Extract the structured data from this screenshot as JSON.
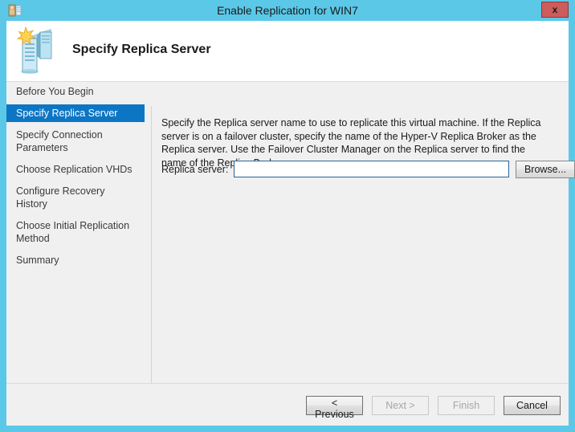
{
  "window": {
    "title": "Enable Replication for WIN7",
    "title_icon": "vm-replication-icon",
    "close_label": "x",
    "frame_color": "#5bc8e8",
    "titlebar_color": "#5bc8e8",
    "close_color": "#cd5c5c",
    "accent_color": "#0d76c4"
  },
  "header": {
    "title": "Specify Replica Server",
    "icon": "two-servers-starburst-icon"
  },
  "sidebar": {
    "items": [
      {
        "label": "Before You Begin",
        "selected": false
      },
      {
        "label": "Specify Replica Server",
        "selected": true
      },
      {
        "label": "Specify Connection Parameters",
        "selected": false
      },
      {
        "label": "Choose Replication VHDs",
        "selected": false
      },
      {
        "label": "Configure Recovery History",
        "selected": false
      },
      {
        "label": "Choose Initial Replication Method",
        "selected": false
      },
      {
        "label": "Summary",
        "selected": false
      }
    ]
  },
  "content": {
    "description": "Specify the Replica server name to use to replicate this virtual machine. If the Replica server is on a failover cluster, specify the name of the Hyper-V Replica Broker as the Replica server. Use the Failover Cluster Manager on the Replica server to find the name of the Replica Broker.",
    "field_label": "Replica server:",
    "field_value": "",
    "field_placeholder": "",
    "browse_label": "Browse..."
  },
  "buttons": {
    "previous": {
      "label": "< Previous",
      "enabled": true
    },
    "next": {
      "label": "Next >",
      "enabled": false
    },
    "finish": {
      "label": "Finish",
      "enabled": false
    },
    "cancel": {
      "label": "Cancel",
      "enabled": true
    }
  }
}
